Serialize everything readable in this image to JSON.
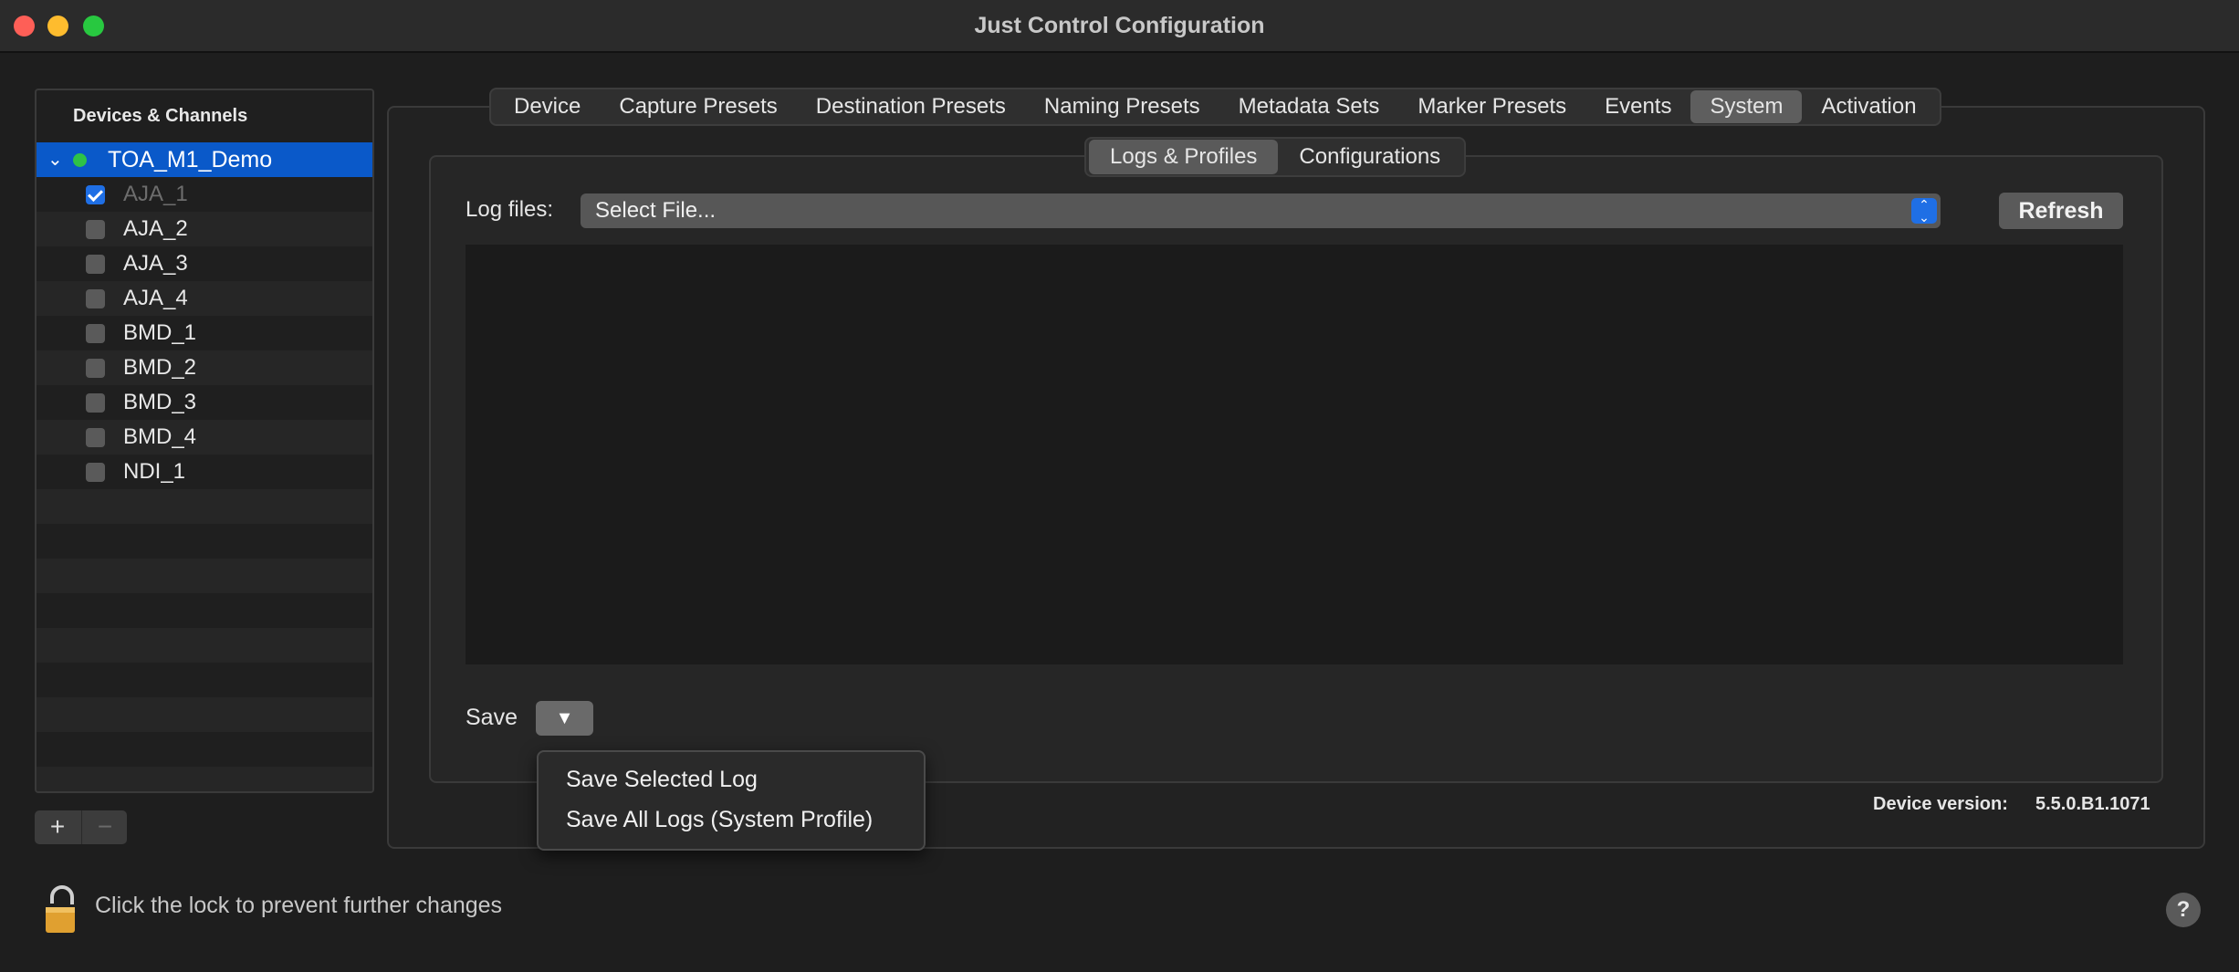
{
  "window": {
    "title": "Just Control Configuration"
  },
  "sidebar": {
    "header": "Devices & Channels",
    "device": {
      "name": "TOA_M1_Demo",
      "status_color": "#2ec247"
    },
    "channels": [
      {
        "label": "AJA_1",
        "checked": true,
        "dimmed": true
      },
      {
        "label": "AJA_2",
        "checked": false
      },
      {
        "label": "AJA_3",
        "checked": false
      },
      {
        "label": "AJA_4",
        "checked": false
      },
      {
        "label": "BMD_1",
        "checked": false
      },
      {
        "label": "BMD_2",
        "checked": false
      },
      {
        "label": "BMD_3",
        "checked": false
      },
      {
        "label": "BMD_4",
        "checked": false
      },
      {
        "label": "NDI_1",
        "checked": false
      }
    ],
    "add_label": "+",
    "remove_label": "−"
  },
  "tabs": {
    "items": [
      "Device",
      "Capture Presets",
      "Destination Presets",
      "Naming Presets",
      "Metadata Sets",
      "Marker Presets",
      "Events",
      "System",
      "Activation"
    ],
    "active": "System"
  },
  "subtabs": {
    "items": [
      "Logs & Profiles",
      "Configurations"
    ],
    "active": "Logs & Profiles"
  },
  "logs": {
    "label": "Log files:",
    "select_value": "Select File...",
    "refresh_label": "Refresh",
    "save_label": "Save",
    "save_button_glyph": "▼"
  },
  "save_menu": {
    "items": [
      "Save Selected Log",
      "Save All Logs (System Profile)"
    ]
  },
  "device_version": {
    "label": "Device version:",
    "value": "5.5.0.B1.1071"
  },
  "footer": {
    "lock_text": "Click the lock to prevent further changes",
    "help_label": "?"
  },
  "colors": {
    "accent": "#0a59c9",
    "checkbox": "#1f6fe5",
    "status_green": "#2ec247",
    "lock_gold": "#e0a030"
  }
}
